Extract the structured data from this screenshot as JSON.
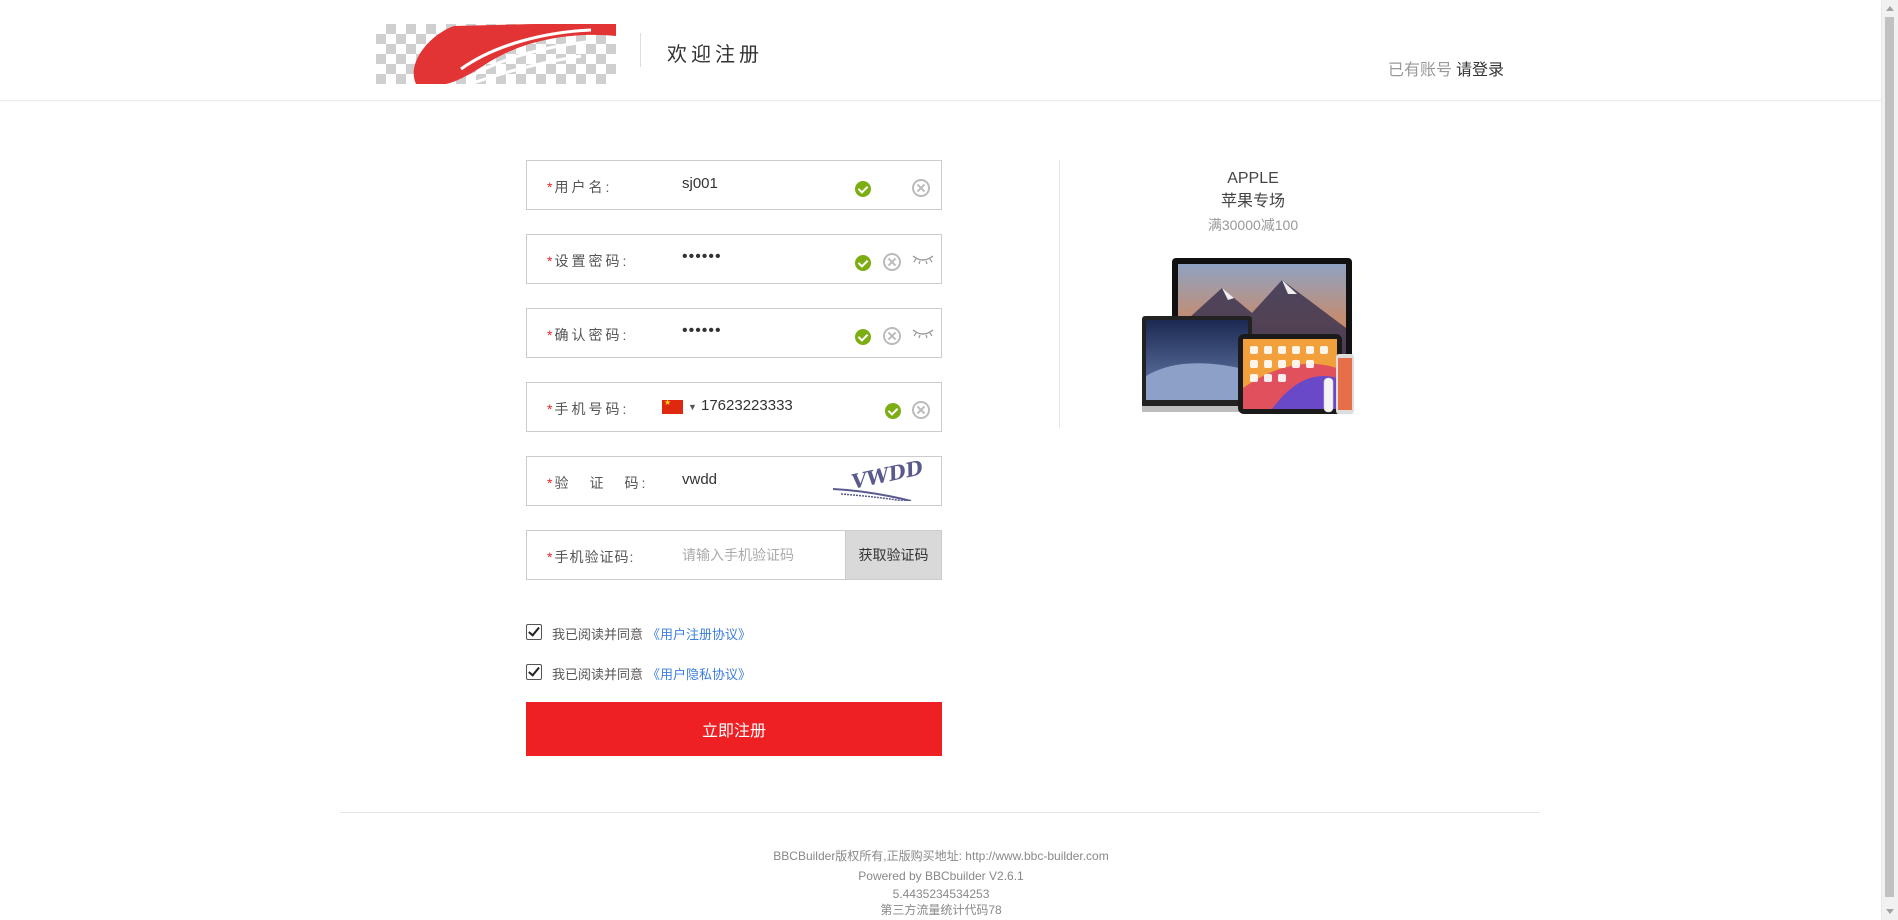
{
  "header": {
    "title": "欢迎注册",
    "have_account": "已有账号",
    "login_link": "请登录"
  },
  "form": {
    "username": {
      "label": "用户名:",
      "value": "sj001"
    },
    "password": {
      "label": "设置密码:",
      "value": "••••••"
    },
    "confirm_password": {
      "label": "确认密码:",
      "value": "••••••"
    },
    "phone": {
      "label": "手机号码:",
      "value": "17623223333"
    },
    "captcha": {
      "label_chars": [
        "验",
        "证",
        "码:"
      ],
      "value": "vwdd",
      "image_text": "VWDD"
    },
    "sms_code": {
      "label": "手机验证码:",
      "placeholder": "请输入手机验证码",
      "button": "获取验证码"
    },
    "agree_text": "我已阅读并同意",
    "agree_user_link": "《用户注册协议》",
    "agree_privacy_link": "《用户隐私协议》",
    "submit": "立即注册",
    "required_mark": "*"
  },
  "promo": {
    "brand": "APPLE",
    "subtitle": "苹果专场",
    "deal": "满30000减100"
  },
  "footer": {
    "copyright": "BBCBuilder版权所有,正版购买地址: http://www.bbc-builder.com",
    "powered": "Powered by BBCbuilder V2.6.1",
    "number": "5.4435234534253",
    "stats": "第三方流量统计代码78"
  },
  "colors": {
    "accent": "#ee2024",
    "link": "#3d7fdc",
    "success": "#7cae12"
  }
}
